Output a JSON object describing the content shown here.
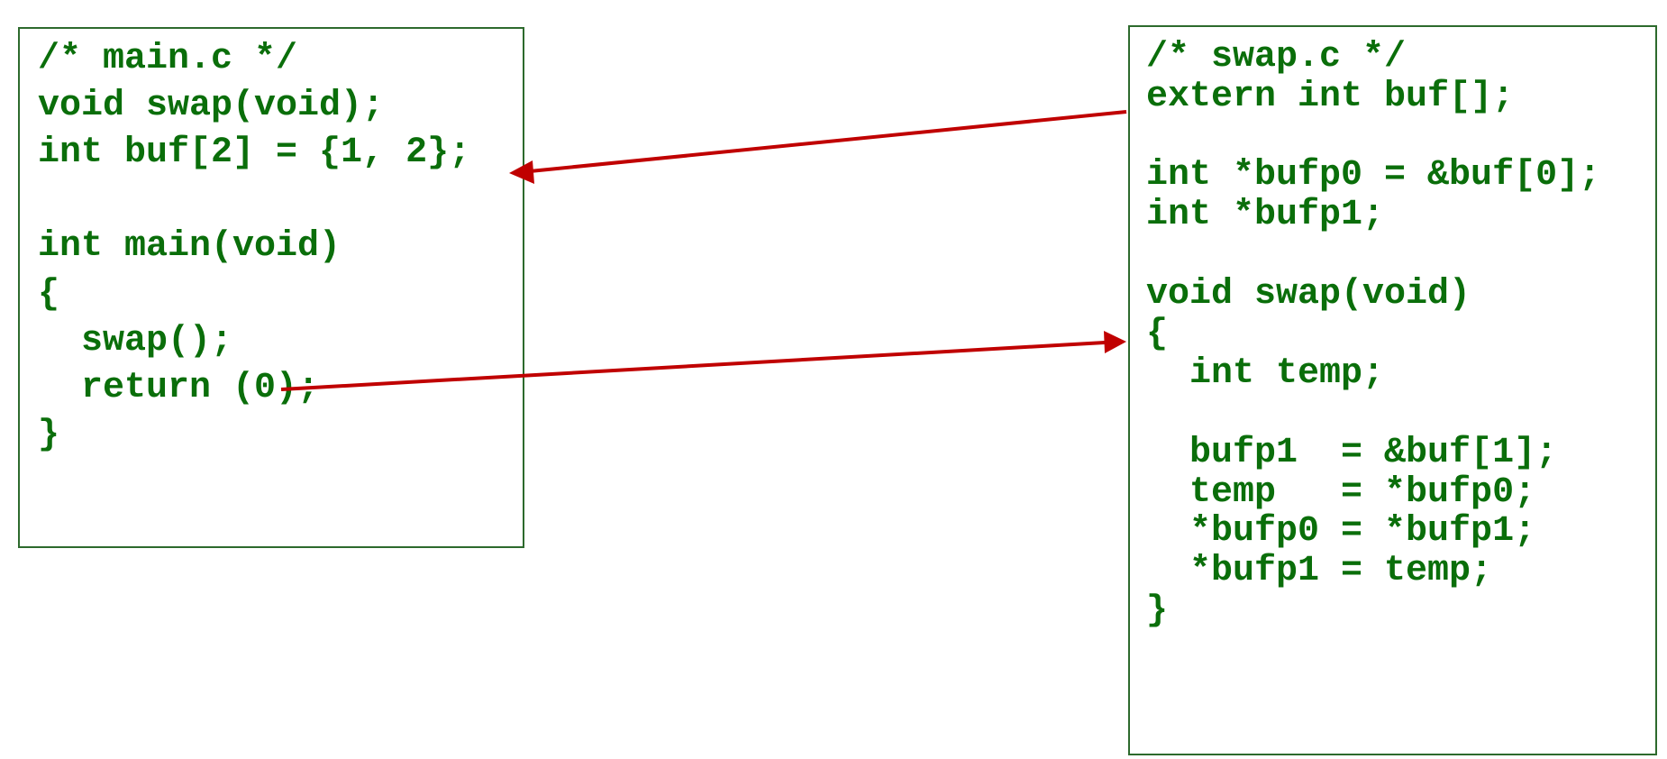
{
  "main_file": {
    "lines": [
      "/* main.c */",
      "void swap(void);",
      "int buf[2] = {1, 2};",
      "",
      "int main(void)",
      "{",
      "  swap();",
      "  return (0);",
      "}"
    ]
  },
  "swap_file": {
    "lines": [
      "/* swap.c */",
      "extern int buf[];",
      "",
      "int *bufp0 = &buf[0];",
      "int *bufp1;",
      "",
      "void swap(void)",
      "{",
      "  int temp;",
      "",
      "  bufp1  = &buf[1];",
      "  temp   = *bufp0;",
      "  *bufp0 = *bufp1;",
      "  *bufp1 = temp;",
      "}"
    ]
  },
  "arrows": [
    {
      "from": "swap.c: extern int buf[];",
      "to": "main.c: int buf[2] = {1, 2};"
    },
    {
      "from": "main.c: swap();",
      "to": "swap.c: void swap(void)"
    }
  ],
  "colors": {
    "code_text": "#0a6e0a",
    "box_border": "#2d6a2d",
    "arrow": "#c00000",
    "background": "#ffffff"
  }
}
